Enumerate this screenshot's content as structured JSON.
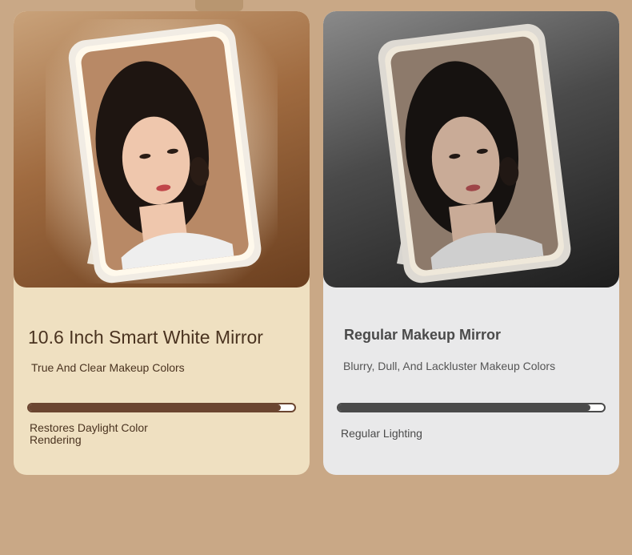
{
  "colors": {
    "page_background": "#c9a886",
    "left_card": "#efe0c1",
    "right_card": "#e9e9ea",
    "left_accent": "#6b4530",
    "right_accent": "#4a4a4a"
  },
  "cards": [
    {
      "title": "10.6 Inch Smart White Mirror",
      "subtitle": "True And Clear Makeup Colors",
      "bar_level_percent": 95,
      "bar_label": "Restores Daylight Color Rendering"
    },
    {
      "title": "Regular Makeup Mirror",
      "subtitle": "Blurry, Dull, And Lackluster Makeup Colors",
      "bar_level_percent": 95,
      "bar_label": "Regular Lighting"
    }
  ]
}
